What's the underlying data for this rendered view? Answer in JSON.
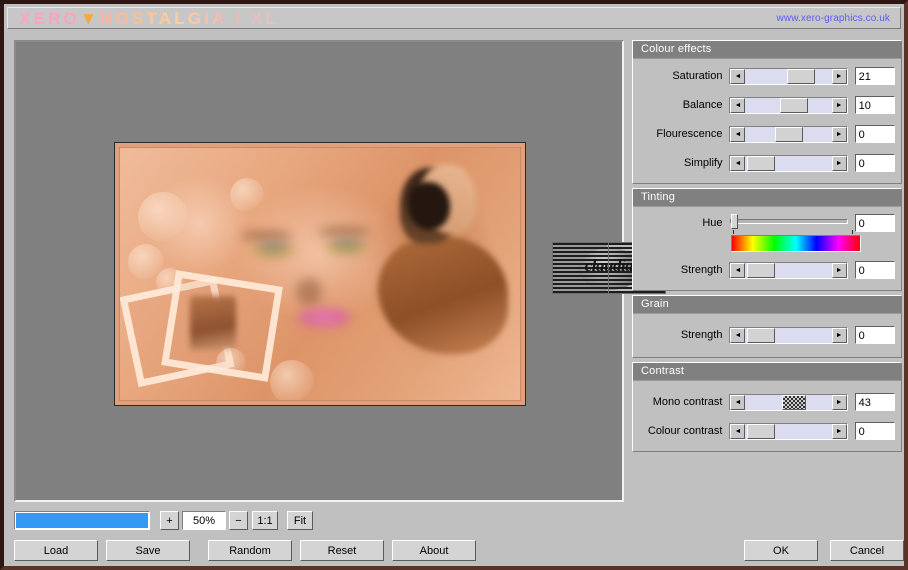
{
  "window": {
    "brand_prefix": "XERO",
    "brand_marker": "▼",
    "brand_suffix": "NOSTALGIA / XL",
    "site_url": "www.xero-graphics.co.uk",
    "accent_colors": {
      "outer_border": "#3a1f18",
      "panel_face": "#c0c0c0",
      "panel_header": "#808080",
      "slider_track": "#dcdcf0",
      "progress": "#3399f5",
      "url_text": "#5d5df0",
      "canvas_bg": "#808080"
    }
  },
  "watermark": {
    "text": "claudia"
  },
  "panels": [
    {
      "title": "Colour effects",
      "controls": [
        {
          "label": "Saturation",
          "value": "21",
          "type": "scrollbar",
          "thumb_pct": 48
        },
        {
          "label": "Balance",
          "value": "10",
          "type": "scrollbar",
          "thumb_pct": 40
        },
        {
          "label": "Flourescence",
          "value": "0",
          "type": "scrollbar",
          "thumb_pct": 34
        },
        {
          "label": "Simplify",
          "value": "0",
          "type": "scrollbar",
          "thumb_pct": 2
        }
      ]
    },
    {
      "title": "Tinting",
      "controls": [
        {
          "label": "Hue",
          "value": "0",
          "type": "trackbar",
          "thumb_pct": 1
        },
        {
          "label": "Strength",
          "value": "0",
          "type": "scrollbar",
          "thumb_pct": 2
        }
      ],
      "has_hue_gradient": true
    },
    {
      "title": "Grain",
      "controls": [
        {
          "label": "Strength",
          "value": "0",
          "type": "scrollbar",
          "thumb_pct": 2
        }
      ]
    },
    {
      "title": "Contrast",
      "controls": [
        {
          "label": "Mono contrast",
          "value": "43",
          "type": "scrollbar",
          "thumb_pct": 42,
          "thumb_style": "dither"
        },
        {
          "label": "Colour contrast",
          "value": "0",
          "type": "scrollbar",
          "thumb_pct": 2
        }
      ]
    }
  ],
  "scrollbar_arrows": {
    "left": "◄",
    "right": "►"
  },
  "bottom": {
    "progress_percent": 100,
    "zoom_in_label": "+",
    "zoom_value": "50%",
    "zoom_out_label": "−",
    "actual_size_label": "1:1",
    "fit_label": "Fit",
    "buttons": [
      {
        "label": "Load",
        "name": "load-button"
      },
      {
        "label": "Save",
        "name": "save-button"
      },
      {
        "label": "Random",
        "name": "random-button"
      },
      {
        "label": "Reset",
        "name": "reset-button"
      },
      {
        "label": "About",
        "name": "about-button"
      }
    ]
  },
  "dialog": {
    "ok_label": "OK",
    "cancel_label": "Cancel"
  }
}
